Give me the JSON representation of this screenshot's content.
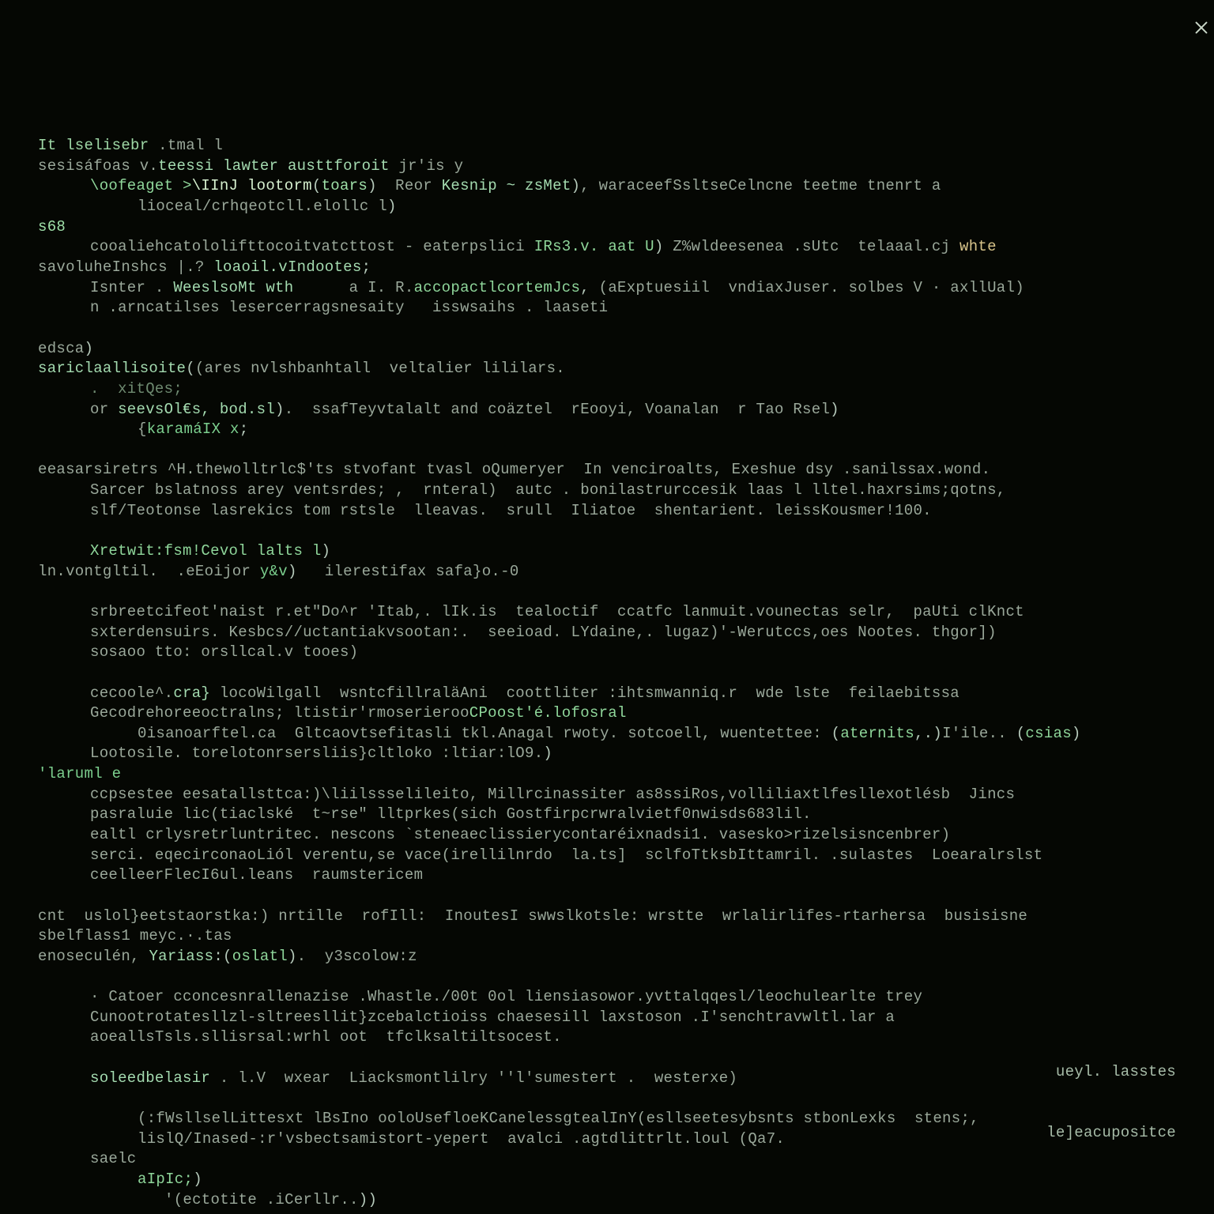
{
  "close_icon_name": "close-icon",
  "lines": [
    {
      "cls": "",
      "spans": [
        {
          "c": "kw",
          "t": "It lselisebr"
        },
        {
          "c": "dim",
          "t": " .tmal l"
        }
      ]
    },
    {
      "cls": "",
      "spans": [
        {
          "c": "dim",
          "t": "sesisáfoas v."
        },
        {
          "c": "fn",
          "t": "teessi lawter austtforoit"
        },
        {
          "c": "dim",
          "t": " jr'is y"
        }
      ]
    },
    {
      "cls": "indent1",
      "spans": [
        {
          "c": "type",
          "t": "\\oofeaget >"
        },
        {
          "c": "hi",
          "t": "\\IInJ lootorm"
        },
        {
          "c": "bracket",
          "t": "("
        },
        {
          "c": "num",
          "t": "toars"
        },
        {
          "c": "bracket",
          "t": ")"
        },
        {
          "c": "dim",
          "t": "  Reor "
        },
        {
          "c": "fn",
          "t": "Kesnip ~ zsMet"
        },
        {
          "c": "bracket",
          "t": ")"
        },
        {
          "c": "dim",
          "t": ", waraceefSsltseCelncne teetme tnenrt a"
        }
      ]
    },
    {
      "cls": "indent2",
      "spans": [
        {
          "c": "dim",
          "t": "lioceal/crhqeotcll.elollc l"
        },
        {
          "c": "bracket",
          "t": ")"
        }
      ]
    },
    {
      "cls": "",
      "spans": [
        {
          "c": "num",
          "t": "s68"
        }
      ]
    },
    {
      "cls": "indent1",
      "spans": [
        {
          "c": "dim",
          "t": "cooaliehcatololifttocoitvatcttost - eaterpslici "
        },
        {
          "c": "type",
          "t": "IRs3.v. aat U"
        },
        {
          "c": "bracket",
          "t": ")"
        },
        {
          "c": "dim",
          "t": " Z%wldeesenea .sUtc  telaaal.cj "
        },
        {
          "c": "err",
          "t": "whte"
        }
      ]
    },
    {
      "cls": "",
      "spans": [
        {
          "c": "dim",
          "t": "savoluheInshcs |.? "
        },
        {
          "c": "fn",
          "t": "loaoil.vIndootes"
        },
        {
          "c": "bracket",
          "t": ";"
        }
      ]
    },
    {
      "cls": "indent1",
      "spans": [
        {
          "c": "dim",
          "t": "Isnter . "
        },
        {
          "c": "fn",
          "t": "WeeslsoMt wth"
        },
        {
          "c": "dim",
          "t": "      a I. R."
        },
        {
          "c": "type",
          "t": "accopactlcortemJcs"
        },
        {
          "c": "bracket",
          "t": ","
        },
        {
          "c": "dim",
          "t": " (aExptuesiil  vndiaxJuser. solbes V · axllUal)"
        }
      ]
    },
    {
      "cls": "indent1",
      "spans": [
        {
          "c": "dim",
          "t": "n .arncatilses lesercerragsnesaity   isswsaihs . laaseti"
        }
      ]
    },
    {
      "cls": "",
      "spans": []
    },
    {
      "cls": "",
      "spans": [
        {
          "c": "dim",
          "t": "edsca"
        },
        {
          "c": "bracket",
          "t": ")"
        }
      ]
    },
    {
      "cls": "",
      "spans": [
        {
          "c": "fn",
          "t": "sariclaallisoite"
        },
        {
          "c": "bracket",
          "t": "("
        },
        {
          "c": "dim",
          "t": "(ares nvlshbanhtall  veltalier lililars."
        }
      ]
    },
    {
      "cls": "indent1",
      "spans": [
        {
          "c": "cmt",
          "t": ".  xitQes;"
        }
      ]
    },
    {
      "cls": "indent1",
      "spans": [
        {
          "c": "dim",
          "t": "or "
        },
        {
          "c": "fn",
          "t": "seevsOl€s, bod.sl"
        },
        {
          "c": "bracket",
          "t": ")"
        },
        {
          "c": "dim",
          "t": ".  ssafTeyvtalalt and coäztel  rEooyi, Voanalan  r Tao Rsel"
        },
        {
          "c": "bracket",
          "t": ")"
        }
      ]
    },
    {
      "cls": "indent2",
      "spans": [
        {
          "c": "dim",
          "t": "{"
        },
        {
          "c": "str",
          "t": "karamáIX x"
        },
        {
          "c": "bracket",
          "t": ";"
        }
      ]
    },
    {
      "cls": "",
      "spans": []
    },
    {
      "cls": "",
      "spans": [
        {
          "c": "dim",
          "t": "eeasarsiretrs ^H.thewolltrlc$'ts stvofant tvasl oQumeryer  In venciroalts, Exeshue dsy .sanilssax.wond."
        }
      ]
    },
    {
      "cls": "indent1",
      "spans": [
        {
          "c": "dim",
          "t": "Sarcer bslatnoss arey ventsrdes; ,  rnteral)  autc . bonilastrurccesik laas l lltel.haxrsims;qotns,"
        }
      ]
    },
    {
      "cls": "indent1",
      "spans": [
        {
          "c": "dim",
          "t": "slf/Teotonse lasrekics tom rstsle  lleavas.  srull  Iliatoe  shentarient. leissKousmer!100."
        }
      ]
    },
    {
      "cls": "",
      "spans": []
    },
    {
      "cls": "indent1",
      "spans": [
        {
          "c": "type",
          "t": "Xretwit:fsm!Cevol lalts l"
        },
        {
          "c": "bracket",
          "t": ")"
        }
      ]
    },
    {
      "cls": "",
      "spans": [
        {
          "c": "dim",
          "t": "ln.vontgltil.  .eEoijor "
        },
        {
          "c": "str",
          "t": "y&v"
        },
        {
          "c": "bracket",
          "t": ")"
        },
        {
          "c": "dim",
          "t": "   ilerestifax safa}o.-0"
        }
      ]
    },
    {
      "cls": "",
      "spans": []
    },
    {
      "cls": "indent1",
      "spans": [
        {
          "c": "dim",
          "t": "srbreetcifeot'naist r.et\"Do^r 'Itab,. lIk.is  tealoctif  ccatfc lanmuit.vounectas selr,  paUti clKnct"
        }
      ]
    },
    {
      "cls": "indent1",
      "spans": [
        {
          "c": "dim",
          "t": "sxterdensuirs. Kesbcs//uctantiakvsootan:.  seeioad. LYdaine,. lugaz)'-Werutccs,oes Nootes. thgor])"
        }
      ]
    },
    {
      "cls": "indent1",
      "spans": [
        {
          "c": "dim",
          "t": "sosaoo tto: orsllcal.v tooes)"
        }
      ]
    },
    {
      "cls": "",
      "spans": []
    },
    {
      "cls": "indent1",
      "spans": [
        {
          "c": "dim",
          "t": "cecoole^."
        },
        {
          "c": "fn",
          "t": "cra}"
        },
        {
          "c": "dim",
          "t": " locoWilgall  wsntcfillraläAni  coottliter :ihtsmwanniq.r  wde lste  feilaebitssa"
        }
      ]
    },
    {
      "cls": "indent1",
      "spans": [
        {
          "c": "dim",
          "t": "Gecodrehoreeoctralns; ltistir'rmoserieroo"
        },
        {
          "c": "type",
          "t": "CPoost'é.lofosral"
        }
      ]
    },
    {
      "cls": "indent2",
      "spans": [
        {
          "c": "dim",
          "t": "0isanoarftel.ca  Gltcaovtsefitasli tkl.Anagal rwoty. sotcoell, wuentettee: "
        },
        {
          "c": "bracket",
          "t": "("
        },
        {
          "c": "type",
          "t": "aternits"
        },
        {
          "c": "bracket",
          "t": ",.)"
        },
        {
          "c": "dim",
          "t": "I'ile.. "
        },
        {
          "c": "bracket",
          "t": "("
        },
        {
          "c": "type",
          "t": "csias"
        },
        {
          "c": "bracket",
          "t": ")"
        }
      ]
    },
    {
      "cls": "indent1",
      "spans": [
        {
          "c": "dim",
          "t": "Lootosile. torelotonrsersliis}cltloko :ltiar:lO9."
        },
        {
          "c": "bracket",
          "t": ")"
        }
      ]
    },
    {
      "cls": "",
      "spans": [
        {
          "c": "str",
          "t": "'laruml e"
        }
      ]
    },
    {
      "cls": "indent1",
      "spans": [
        {
          "c": "dim",
          "t": "ccpsestee eesatallsttca:)\\liilssselileito, Millrcinassiter as8ssiRos,volliliaxtlfesllexotlésb  Jincs"
        }
      ]
    },
    {
      "cls": "indent1",
      "spans": [
        {
          "c": "dim",
          "t": "pasraluie lic(tiaclské  t~rse\" lltprkes(sich Gostfirpcrwralvietf0nwisds683lil."
        }
      ]
    },
    {
      "cls": "indent1",
      "spans": [
        {
          "c": "dim",
          "t": "ealtl crlysretrluntritec. nescons `steneaeclissierycontaréixnadsi1. vasesko>rizelsisncenbrer)"
        }
      ]
    },
    {
      "cls": "indent1",
      "spans": [
        {
          "c": "dim",
          "t": "serci. eqecirconaoLiól verentu,se vace(irellilnrdo  la.ts]  sclfoTtksbIttamril. .sulastes  Loearalrslst"
        }
      ]
    },
    {
      "cls": "indent1",
      "spans": [
        {
          "c": "dim",
          "t": "ceelleerFlecI6ul.leans  raumstericem"
        }
      ]
    },
    {
      "cls": "",
      "spans": []
    },
    {
      "cls": "",
      "spans": [
        {
          "c": "dim",
          "t": "cnt  uslol}eetstaorstka:) nrtille  rofIll:  InoutesI swwslkotsle: wrstte  wrlalirlifes-rtarhersa  busisisne"
        }
      ]
    },
    {
      "cls": "",
      "spans": [
        {
          "c": "dim",
          "t": "sbelflass1 meyc.·.tas"
        }
      ]
    },
    {
      "cls": "",
      "spans": [
        {
          "c": "dim",
          "t": "enoseculén, "
        },
        {
          "c": "fn",
          "t": "Yariass"
        },
        {
          "c": "bracket",
          "t": ":("
        },
        {
          "c": "type",
          "t": "oslatl"
        },
        {
          "c": "bracket",
          "t": ")"
        },
        {
          "c": "dim",
          "t": ".  y3scolow:z"
        }
      ]
    },
    {
      "cls": "",
      "spans": []
    },
    {
      "cls": "indent1",
      "spans": [
        {
          "c": "dim",
          "t": "· Catoer cconcesnrallenazise .Whastle./00t 0ol liensiasowor.yvttalqqesl/leochulearlte trey"
        }
      ]
    },
    {
      "cls": "indent1",
      "spans": [
        {
          "c": "dim",
          "t": "Cunootrotatesllzl-sltreesllit}zcebalctioiss chaesesill laxstoson .I'senchtravwltl.lar a"
        }
      ]
    },
    {
      "cls": "indent1",
      "spans": [
        {
          "c": "dim",
          "t": "aoeallsTsls.sllisrsal:wrhl oot  tfclksaltiltsocest."
        }
      ]
    },
    {
      "cls": "",
      "spans": []
    },
    {
      "cls": "indent1",
      "spans": [
        {
          "c": "fn",
          "t": "soleedbelasir"
        },
        {
          "c": "dim",
          "t": " . l.V  wxear  Liacksmontlilry ''l'sumestert .  westerxe)"
        }
      ]
    },
    {
      "cls": "",
      "spans": []
    },
    {
      "cls": "indent2",
      "spans": [
        {
          "c": "dim",
          "t": "(:fWsllselLittesxt lBsIno ooloUsefloeKCanelessgtealInY(esllseetesybsnts stbonLexks  stens;,"
        }
      ]
    },
    {
      "cls": "indent2",
      "spans": [
        {
          "c": "dim",
          "t": "lislQ/Inased-:r'vsbectsamistort-yepert  avalci .agtdlittrlt.loul (Qa7."
        }
      ]
    },
    {
      "cls": "indent1",
      "spans": [
        {
          "c": "dim",
          "t": "saelc"
        }
      ]
    },
    {
      "cls": "indent2",
      "spans": [
        {
          "c": "type",
          "t": "aIpIc;"
        },
        {
          "c": "bracket",
          "t": ")"
        }
      ]
    },
    {
      "cls": "indent3",
      "spans": [
        {
          "c": "dim",
          "t": "'(ectotite .iCerllr.."
        },
        {
          "c": "bracket",
          "t": "))"
        }
      ]
    }
  ],
  "footer": {
    "line1": "ueyl. lasstes",
    "line2": "le]eacupositce"
  }
}
